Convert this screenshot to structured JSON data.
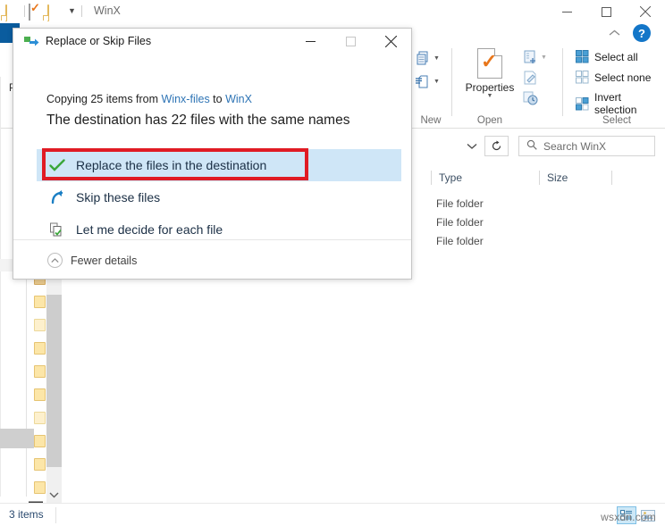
{
  "explorer": {
    "window_title": "WinX",
    "quick_access": [
      {
        "name": "new-folder-icon",
        "label": "New folder"
      },
      {
        "name": "properties-icon",
        "label": "Properties"
      },
      {
        "name": "folder-icon",
        "label": "Folder"
      },
      {
        "name": "customize-quick-access-icon",
        "label": "Customize Quick Access Toolbar"
      }
    ],
    "window_controls": [
      {
        "name": "minimize-button",
        "label": "Minimize"
      },
      {
        "name": "maximize-button",
        "label": "Maximize"
      },
      {
        "name": "close-button",
        "label": "Close"
      }
    ],
    "ribbon": {
      "collapse_label": "Collapse the Ribbon",
      "help_label": "?",
      "groups": [
        {
          "name": "new",
          "label": "New"
        },
        {
          "name": "open",
          "label": "Open"
        },
        {
          "name": "select",
          "label": "Select"
        }
      ],
      "open_group": {
        "properties_label": "Properties"
      },
      "select_group": {
        "items": [
          {
            "name": "select-all",
            "label": "Select all"
          },
          {
            "name": "select-none",
            "label": "Select none"
          },
          {
            "name": "invert-selection",
            "label": "Invert selection"
          }
        ]
      }
    },
    "address_bar": {
      "history_label": "Previous locations",
      "refresh_label": "Refresh"
    },
    "search": {
      "placeholder": "Search WinX",
      "value": ""
    },
    "columns": [
      {
        "name": "type",
        "label": "Type"
      },
      {
        "name": "size",
        "label": "Size"
      }
    ],
    "rows": [
      {
        "type": "File folder",
        "size": ""
      },
      {
        "type": "File folder",
        "size": ""
      },
      {
        "type": "File folder",
        "size": ""
      }
    ],
    "nav_pane": {
      "visible_text": "P"
    },
    "status": {
      "item_count": "3 items",
      "views": [
        {
          "name": "details-view",
          "label": "Details view",
          "active": true
        },
        {
          "name": "large-icons-view",
          "label": "Large icons view",
          "active": false
        }
      ]
    },
    "watermark": "wsxdn.com"
  },
  "dialog": {
    "title": "Replace or Skip Files",
    "controls": [
      {
        "name": "minimize-button",
        "label": "Minimize"
      },
      {
        "name": "maximize-button",
        "label": "Maximize"
      },
      {
        "name": "close-button",
        "label": "Close"
      }
    ],
    "subtitle": {
      "prefix": "Copying 25 items from ",
      "source": "Winx-files",
      "middle": " to ",
      "destination": "WinX"
    },
    "heading": "The destination has 22 files with the same names",
    "options": [
      {
        "name": "replace-files",
        "label": "Replace the files in the destination",
        "icon": "green-check-icon",
        "selected": true
      },
      {
        "name": "skip-files",
        "label": "Skip these files",
        "icon": "blue-skip-arrow-icon",
        "selected": false
      },
      {
        "name": "decide-each-file",
        "label": "Let me decide for each file",
        "icon": "compare-files-icon",
        "selected": false
      }
    ],
    "footer": {
      "toggle_label": "Fewer details"
    },
    "annotation": {
      "color": "#e01b24"
    }
  },
  "colors": {
    "accent_blue": "#0a5c9e",
    "link_blue": "#2e74b5",
    "selection_blue": "#cfe6f7",
    "annotation_red": "#e01b24",
    "check_green": "#3aa63a",
    "folder_yellow": "#fbe5a8"
  }
}
